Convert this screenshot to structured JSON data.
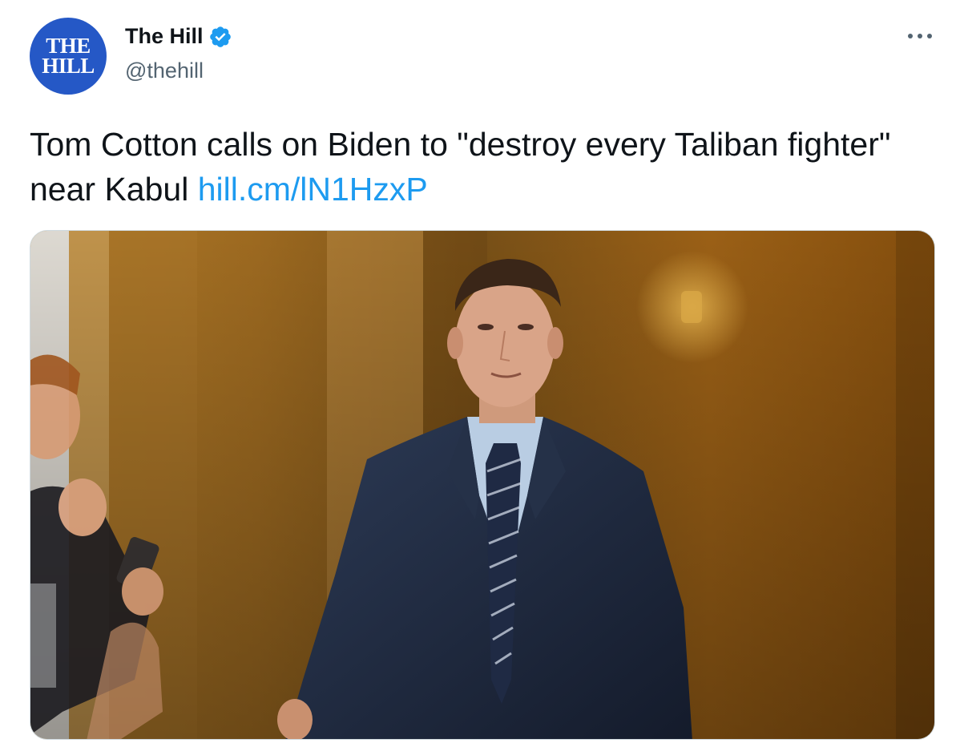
{
  "account": {
    "avatar_text_line1": "THE",
    "avatar_text_line2": "HILL",
    "display_name": "The Hill",
    "handle": "@thehill",
    "verified": true,
    "verified_icon": "verified-badge-icon"
  },
  "menu": {
    "icon": "more-options-icon"
  },
  "tweet": {
    "text": "Tom Cotton calls on Biden to \"destroy every Taliban fighter\" near Kabul ",
    "link_text": "hill.cm/lN1HzxP"
  },
  "media": {
    "description_icon": "photo"
  },
  "colors": {
    "brand_blue": "#2558c6",
    "link": "#1d9bf0",
    "verified": "#1d9bf0",
    "muted": "#536471"
  }
}
